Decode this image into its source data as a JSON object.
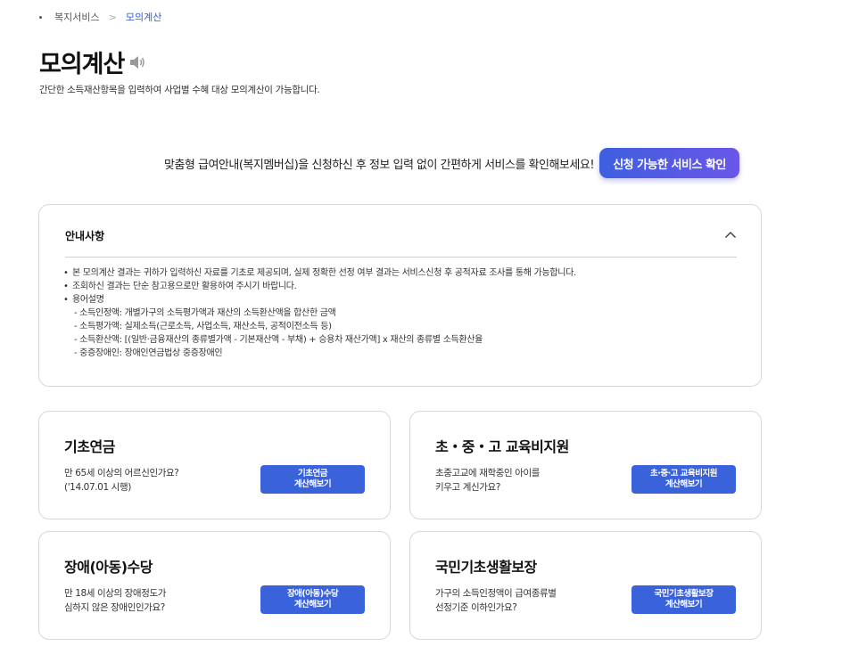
{
  "breadcrumb": {
    "parent": "복지서비스",
    "current": "모의계산"
  },
  "page": {
    "title": "모의계산",
    "description": "간단한 소득재산항목을 입력하여 사업별 수혜 대상 모의계산이 가능합니다."
  },
  "promo": {
    "text": "맞춤형 급여안내(복지멤버십)을 신청하신 후 정보 입력 없이 간편하게 서비스를 확인해보세요!",
    "button_label": "신청 가능한 서비스 확인"
  },
  "notice": {
    "title": "안내사항",
    "items": [
      "본 모의계산 결과는 귀하가 입력하신 자료를 기초로 제공되며, 실제 정확한 선정 여부 결과는 서비스신청 후 공적자료 조사를 통해 가능합니다.",
      "조회하신 결과는 단순 참고용으로만 활용하여 주시기 바랍니다.",
      "용어설명"
    ],
    "sub_items": [
      "- 소득인정액: 개별가구의 소득평가액과 재산의 소득환산액을 합산한 금액",
      "- 소득평가액: 실제소득(근로소득, 사업소득, 재산소득, 공적이전소득 등)",
      "- 소득환산액: [(일반·금융재산의 종류별가액 - 기본재산액 - 부채) + 승용차 재산가액] x 재산의 종류별 소득환산율",
      "- 중증장애인: 장애인연금법상 중증장애인"
    ]
  },
  "cards": [
    {
      "title": "기초연금",
      "desc_line1": "만 65세 이상의 어르신인가요?",
      "desc_line2": "('14.07.01 시행)",
      "btn_line1": "기초연금",
      "btn_line2": "계산해보기"
    },
    {
      "title": "초・중・고 교육비지원",
      "desc_line1": "초중고교에 재학중인 아이를",
      "desc_line2": "키우고 계신가요?",
      "btn_line1": "초·중·고 교육비지원",
      "btn_line2": "계산해보기"
    },
    {
      "title": "장애(아동)수당",
      "desc_line1": "만 18세 이상의 장애정도가",
      "desc_line2": "심하지 않은 장애인인가요?",
      "btn_line1": "장애(아동)수당",
      "btn_line2": "계산해보기"
    },
    {
      "title": "국민기초생활보장",
      "desc_line1": "가구의 소득인정액이 급여종류별",
      "desc_line2": "선정기준 이하인가요?",
      "btn_line1": "국민기초생활보장",
      "btn_line2": "계산해보기"
    }
  ]
}
